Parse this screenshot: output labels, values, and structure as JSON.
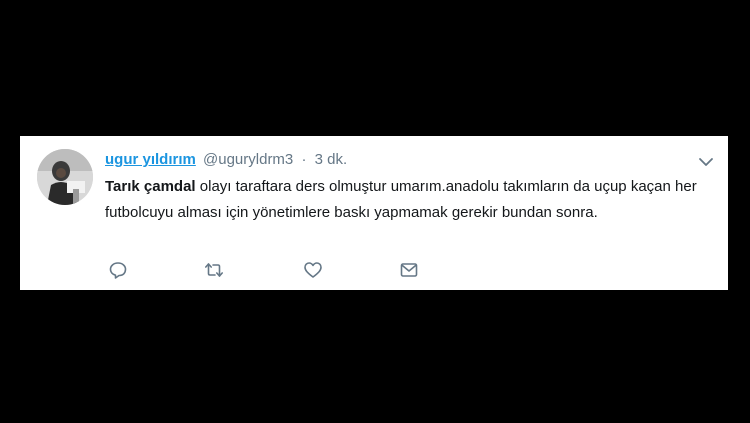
{
  "tweet": {
    "display_name": "ugur yıldırım",
    "handle": "@uguryldrm3",
    "separator": "·",
    "timestamp": "3 dk.",
    "mention": "Tarık çamdal",
    "body": " olayı taraftara ders olmuştur umarım.anadolu takımların da uçup kaçan her futbolcuyu alması için yönetimlere baskı yapmamak gerekir bundan sonra.",
    "avatar_icon": "user-photo",
    "menu_icon": "chevron-down-icon",
    "actions": [
      {
        "name": "reply",
        "icon": "reply-icon"
      },
      {
        "name": "retweet",
        "icon": "retweet-icon"
      },
      {
        "name": "like",
        "icon": "heart-icon"
      },
      {
        "name": "direct-message",
        "icon": "envelope-icon"
      }
    ]
  },
  "colors": {
    "background": "#000000",
    "card": "#ffffff",
    "link_blue": "#1b95e0",
    "text": "#14171a",
    "secondary": "#657786",
    "icon": "#657786"
  }
}
